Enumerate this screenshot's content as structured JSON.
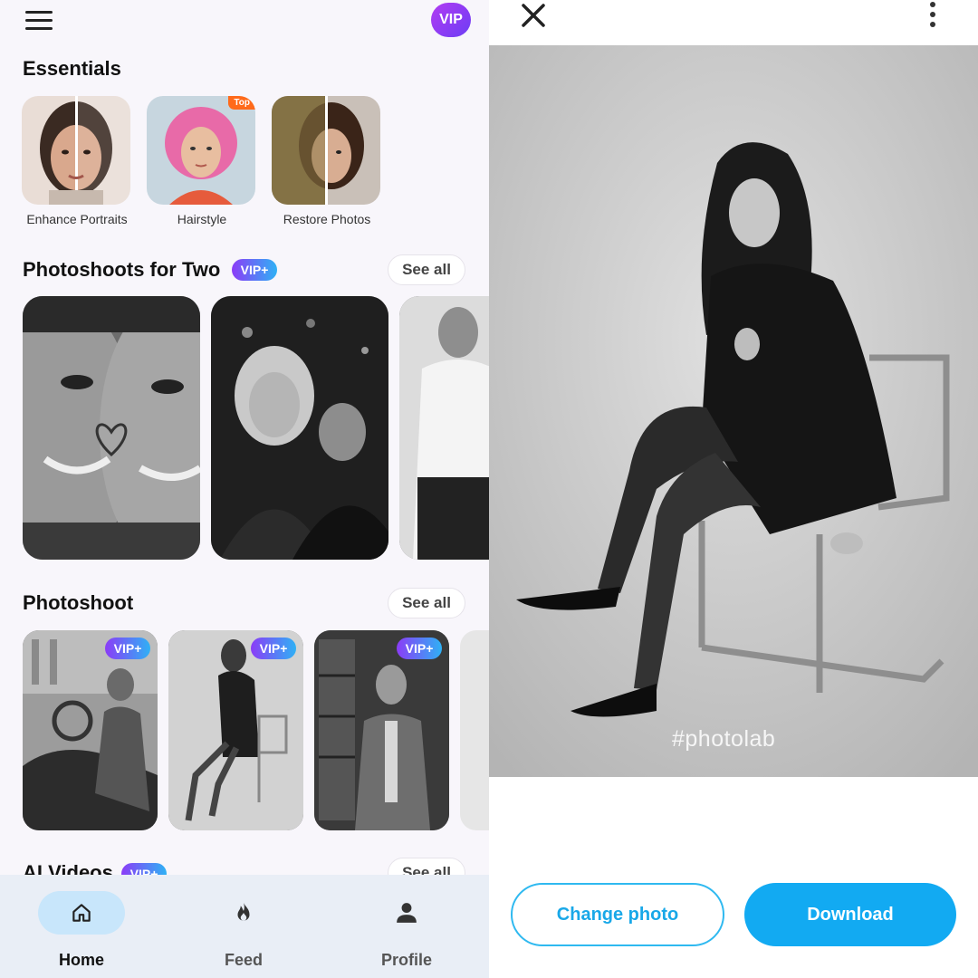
{
  "header": {
    "vip_label": "VIP"
  },
  "essentials": {
    "title": "Essentials",
    "items": [
      {
        "label": "Enhance Portraits"
      },
      {
        "label": "Hairstyle",
        "badge": "Top"
      },
      {
        "label": "Restore Photos"
      }
    ]
  },
  "photoshoots_for_two": {
    "title": "Photoshoots for Two",
    "badge": "VIP+",
    "see_all": "See all"
  },
  "photoshoot": {
    "title": "Photoshoot",
    "see_all": "See all",
    "card_badges": [
      "VIP+",
      "VIP+",
      "VIP+"
    ]
  },
  "ai_videos": {
    "title": "AI Videos",
    "badge": "VIP+",
    "see_all": "See all"
  },
  "bottom_nav": {
    "items": [
      {
        "label": "Home",
        "icon": "home-icon"
      },
      {
        "label": "Feed",
        "icon": "flame-icon"
      },
      {
        "label": "Profile",
        "icon": "person-icon"
      }
    ]
  },
  "editor": {
    "watermark": "#photolab",
    "change_photo": "Change photo",
    "download": "Download"
  },
  "colors": {
    "accent": "#12aaf2",
    "vip_gradient_start": "#8b3cf7",
    "vip_gradient_end": "#2fb1f5",
    "top_badge": "#ff6a1a"
  }
}
